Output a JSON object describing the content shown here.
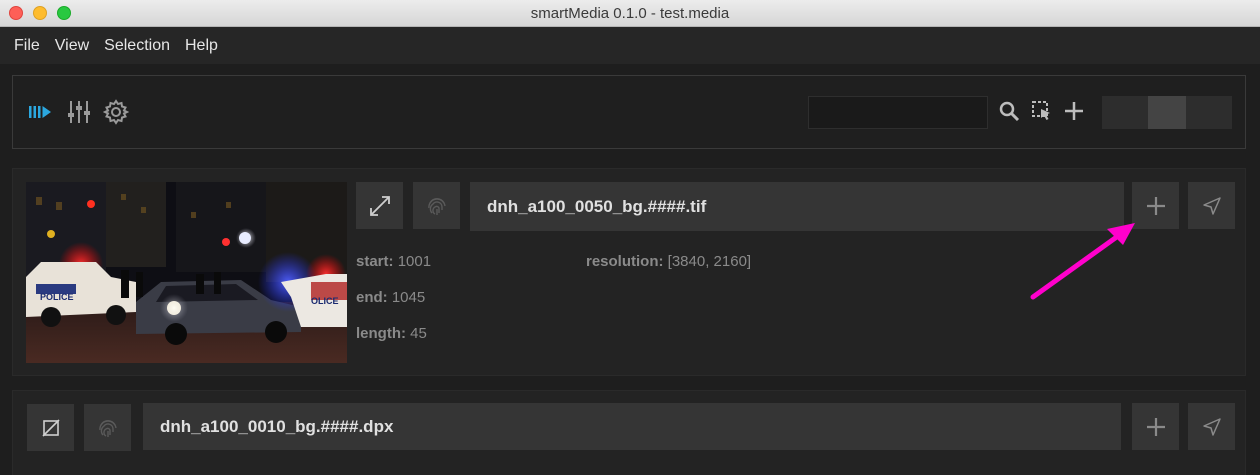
{
  "window": {
    "title": "smartMedia 0.1.0 - test.media"
  },
  "menu": [
    "File",
    "View",
    "Selection",
    "Help"
  ],
  "toolbar": {
    "icons": [
      "media-list-icon",
      "sliders-icon",
      "gear-icon",
      "search-icon",
      "select-region-icon",
      "plus-icon"
    ],
    "search": {
      "value": "",
      "placeholder": ""
    }
  },
  "items": [
    {
      "name": "dnh_a100_0050_bg.####.tif",
      "start_label": "start:",
      "start": "1001",
      "end_label": "end:",
      "end": "1045",
      "length_label": "length:",
      "length": "45",
      "resolution_label": "resolution:",
      "resolution": "[3840, 2160]",
      "thumbnail": "police-cars-night-street"
    },
    {
      "name": "dnh_a100_0010_bg.####.dpx"
    }
  ],
  "colors": {
    "accent": "#2ba8e0",
    "annotation_arrow": "#ff00cc"
  }
}
